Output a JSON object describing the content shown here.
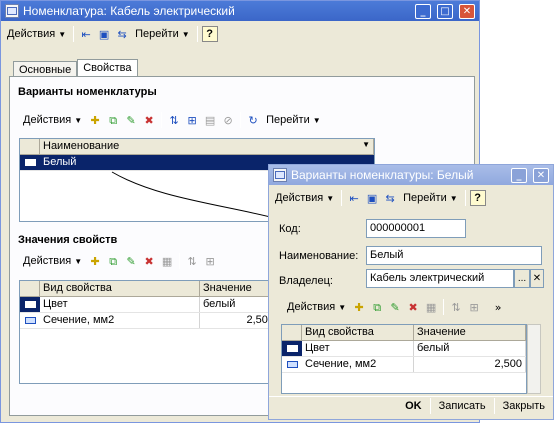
{
  "main": {
    "title": "Номенклатура: Кабель электрический",
    "toolbar": {
      "actions": "Действия",
      "goto": "Перейти",
      "help": "?"
    },
    "tabs": [
      "Основные",
      "Свойства"
    ],
    "variants": {
      "title": "Варианты номенклатуры",
      "actions": "Действия",
      "goto": "Перейти",
      "column": "Наименование",
      "rows": [
        "Белый"
      ]
    },
    "props": {
      "title": "Значения свойств",
      "actions": "Действия",
      "columns": [
        "Вид свойства",
        "Значение"
      ],
      "rows": [
        {
          "name": "Цвет",
          "value": "белый"
        },
        {
          "name": "Сечение, мм2",
          "value": "2,500"
        }
      ]
    }
  },
  "dialog": {
    "title": "Варианты номенклатуры: Белый",
    "toolbar": {
      "actions": "Действия",
      "goto": "Перейти",
      "help": "?"
    },
    "fields": {
      "code_label": "Код:",
      "code_value": "000000001",
      "name_label": "Наименование:",
      "name_value": "Белый",
      "owner_label": "Владелец:",
      "owner_value": "Кабель электрический"
    },
    "props": {
      "actions": "Действия",
      "columns": [
        "Вид свойства",
        "Значение"
      ],
      "rows": [
        {
          "name": "Цвет",
          "value": "белый"
        },
        {
          "name": "Сечение, мм2",
          "value": "2,500"
        }
      ]
    },
    "buttons": {
      "ok": "OK",
      "save": "Записать",
      "close": "Закрыть"
    }
  },
  "colors": {
    "titlebar": "#3b66c8",
    "window_bg": "#ece9d8",
    "selection": "#0a246a"
  }
}
